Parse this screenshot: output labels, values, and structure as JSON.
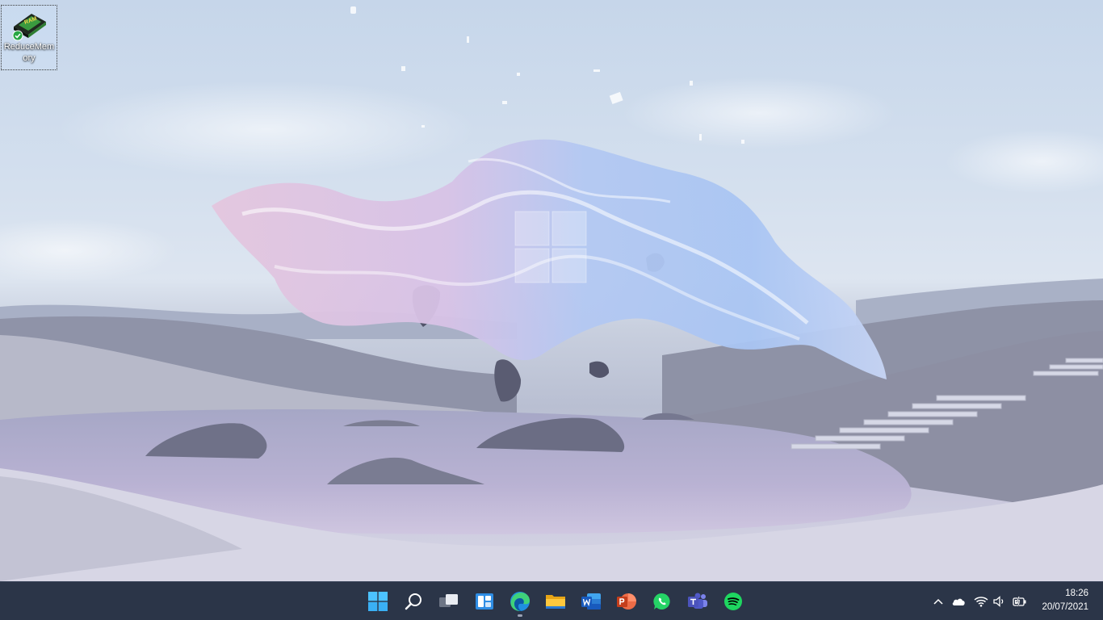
{
  "desktop": {
    "icons": [
      {
        "label": "ReduceMemory",
        "icon": "ram-chip-icon",
        "badge": "green-check-badge"
      }
    ]
  },
  "taskbar": {
    "apps": [
      {
        "name": "Start",
        "icon": "windows-start-icon"
      },
      {
        "name": "Search",
        "icon": "search-icon"
      },
      {
        "name": "Task View",
        "icon": "task-view-icon"
      },
      {
        "name": "Widgets",
        "icon": "widgets-icon"
      },
      {
        "name": "Microsoft Edge",
        "icon": "edge-icon",
        "running": true
      },
      {
        "name": "File Explorer",
        "icon": "file-explorer-icon"
      },
      {
        "name": "Word",
        "icon": "word-icon"
      },
      {
        "name": "PowerPoint",
        "icon": "powerpoint-icon"
      },
      {
        "name": "WhatsApp",
        "icon": "whatsapp-icon"
      },
      {
        "name": "Teams",
        "icon": "teams-icon"
      },
      {
        "name": "Spotify",
        "icon": "spotify-icon"
      }
    ],
    "tray": [
      {
        "icon": "chevron-up-icon"
      },
      {
        "icon": "onedrive-cloud-icon"
      },
      {
        "icon": "wifi-icon"
      },
      {
        "icon": "volume-icon"
      },
      {
        "icon": "battery-charging-icon"
      }
    ],
    "clock": {
      "time": "18:26",
      "date": "20/07/2021"
    }
  },
  "colors": {
    "taskbar_bg": "#2b3548",
    "sky": "#c6d6ea",
    "spotify_green": "#1ed760",
    "whatsapp_green": "#25d366",
    "edge_blue": "#1f8ee0"
  }
}
